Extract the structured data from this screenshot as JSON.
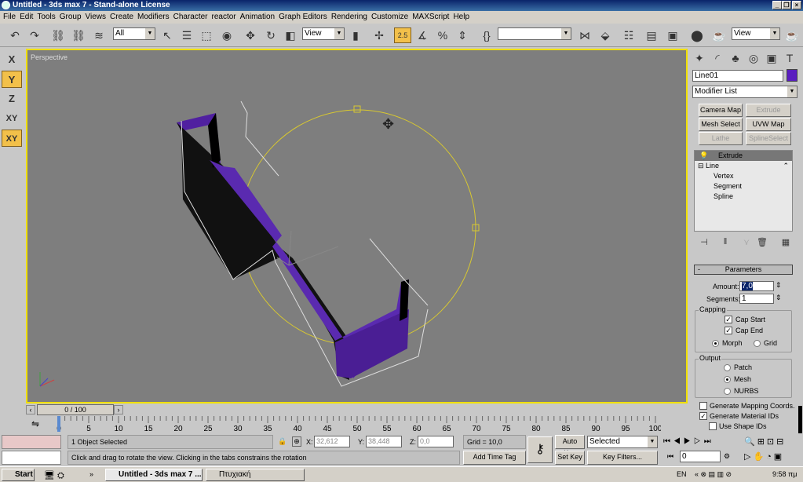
{
  "window": {
    "title": "Untitled - 3ds max 7  - Stand-alone License"
  },
  "menu": [
    "File",
    "Edit",
    "Tools",
    "Group",
    "Views",
    "Create",
    "Modifiers",
    "Character",
    "reactor",
    "Animation",
    "Graph Editors",
    "Rendering",
    "Customize",
    "MAXScript",
    "Help"
  ],
  "toolbar": {
    "selection_filter": "All",
    "ref_coord": "View",
    "named_selection": "",
    "render_type": "View",
    "snap_label": "2.5"
  },
  "axis_constraints": [
    "X",
    "Y",
    "Z",
    "XY",
    "XY"
  ],
  "viewport": {
    "label": "Perspective",
    "object_color": "#4a1e8c",
    "gizmo_color": "#d8c830"
  },
  "panel": {
    "object_name": "Line01",
    "object_color": "#5a1ec0",
    "modifier_list": "Modifier List",
    "modifier_buttons": [
      {
        "label": "Camera Map",
        "enabled": true
      },
      {
        "label": "Extrude",
        "enabled": false
      },
      {
        "label": "Mesh Select",
        "enabled": true
      },
      {
        "label": "UVW Map",
        "enabled": true
      },
      {
        "label": "Lathe",
        "enabled": false
      },
      {
        "label": "SplineSelect",
        "enabled": false
      }
    ],
    "stack": {
      "top": "Extrude",
      "base": "Line",
      "subobjects": [
        "Vertex",
        "Segment",
        "Spline"
      ]
    },
    "parameters": {
      "header": "Parameters",
      "amount_label": "Amount:",
      "amount": "7,0",
      "segments_label": "Segments:",
      "segments": "1",
      "capping_label": "Capping",
      "cap_start": "Cap Start",
      "cap_start_checked": true,
      "cap_end": "Cap End",
      "cap_end_checked": true,
      "morph": "Morph",
      "grid": "Grid",
      "capping_selected": "Morph",
      "output_label": "Output",
      "output_options": [
        "Patch",
        "Mesh",
        "NURBS"
      ],
      "output_selected": "Mesh",
      "gen_mapping": "Generate Mapping Coords.",
      "gen_mapping_checked": false,
      "gen_matids": "Generate Material IDs",
      "gen_matids_checked": true,
      "use_shape_ids": "Use Shape IDs",
      "use_shape_ids_checked": false
    }
  },
  "timeline": {
    "frame": "0 / 100",
    "ticks": [
      "0",
      "5",
      "10",
      "15",
      "20",
      "25",
      "30",
      "35",
      "40",
      "45",
      "50",
      "55",
      "60",
      "65",
      "70",
      "75",
      "80",
      "85",
      "90",
      "95",
      "100"
    ]
  },
  "status": {
    "selected": "1 Object Selected",
    "prompt": "Click and drag to rotate the view.  Clicking in the tabs constrains the rotation",
    "x_label": "X:",
    "x": "32,612",
    "y_label": "Y:",
    "y": "38,448",
    "z_label": "Z:",
    "z": "0,0",
    "grid": "Grid = 10,0",
    "add_time_tag": "Add Time Tag",
    "auto_key": "Auto Key",
    "set_key": "Set Key",
    "key_mode": "Selected",
    "key_filters": "Key Filters...",
    "current_frame": "0"
  },
  "taskbar": {
    "start": "Start",
    "tasks": [
      "Untitled - 3ds max 7 ...",
      "Πτυχιακή"
    ],
    "lang": "EN",
    "clock": "9:58 πμ"
  }
}
